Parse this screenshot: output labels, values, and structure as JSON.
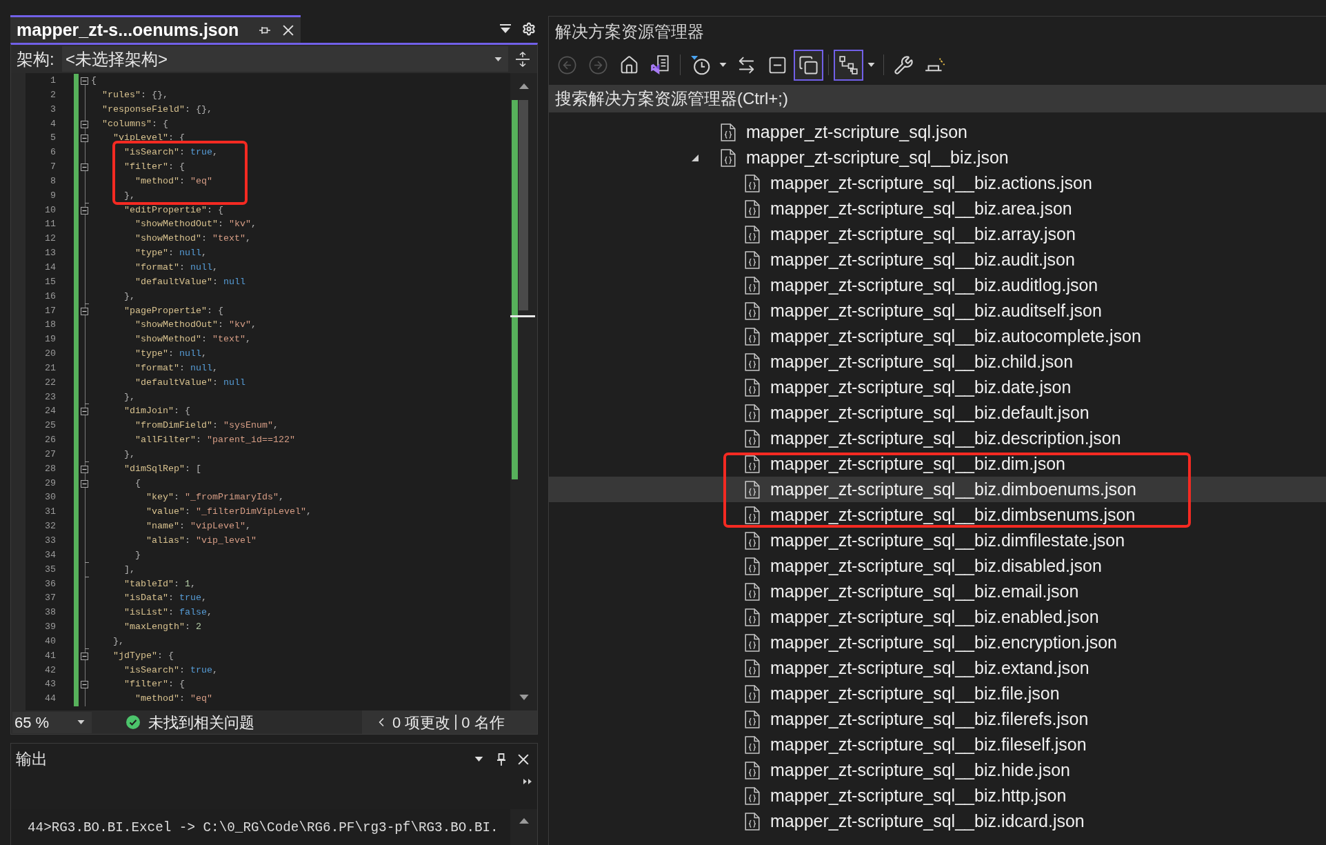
{
  "editor": {
    "tabs": [
      {
        "title": "mapper_zt-s...oenums.json",
        "selected": true
      }
    ],
    "navigation": {
      "label": "架构:",
      "value": "<未选择架构>"
    },
    "lines": [
      {
        "number": "1",
        "changed": true,
        "expanded": true,
        "tokens": [
          {
            "kind": "punct",
            "text": "{"
          }
        ]
      },
      {
        "number": "2",
        "changed": true,
        "tokens": [
          {
            "kind": "key",
            "text": "  \"rules\""
          },
          {
            "kind": "punct",
            "text": ": {},"
          }
        ]
      },
      {
        "number": "3",
        "changed": true,
        "tokens": [
          {
            "kind": "key",
            "text": "  \"responseField\""
          },
          {
            "kind": "punct",
            "text": ": {},"
          }
        ]
      },
      {
        "number": "4",
        "changed": true,
        "expanded": true,
        "tokens": [
          {
            "kind": "key",
            "text": "  \"columns\""
          },
          {
            "kind": "punct",
            "text": ": {"
          }
        ]
      },
      {
        "number": "5",
        "changed": true,
        "expanded": true,
        "tokens": [
          {
            "kind": "key",
            "text": "    \"vipLevel\""
          },
          {
            "kind": "punct",
            "text": ": {"
          }
        ]
      },
      {
        "number": "6",
        "changed": true,
        "tokens": [
          {
            "kind": "key",
            "text": "      \"isSearch\""
          },
          {
            "kind": "punct",
            "text": ": "
          },
          {
            "kind": "keyword",
            "text": "true"
          },
          {
            "kind": "punct",
            "text": ","
          }
        ]
      },
      {
        "number": "7",
        "changed": true,
        "expanded": true,
        "tokens": [
          {
            "kind": "key",
            "text": "      \"filter\""
          },
          {
            "kind": "punct",
            "text": ": {"
          }
        ]
      },
      {
        "number": "8",
        "changed": true,
        "tokens": [
          {
            "kind": "key",
            "text": "        \"method\""
          },
          {
            "kind": "punct",
            "text": ": "
          },
          {
            "kind": "string",
            "text": "\"eq\""
          }
        ]
      },
      {
        "number": "9",
        "changed": true,
        "fold_end": true,
        "tokens": [
          {
            "kind": "punct",
            "text": "      },"
          }
        ]
      },
      {
        "number": "10",
        "changed": true,
        "expanded": true,
        "tokens": [
          {
            "kind": "key",
            "text": "      \"editPropertie\""
          },
          {
            "kind": "punct",
            "text": ": {"
          }
        ]
      },
      {
        "number": "11",
        "changed": true,
        "tokens": [
          {
            "kind": "key",
            "text": "        \"showMethodOut\""
          },
          {
            "kind": "punct",
            "text": ": "
          },
          {
            "kind": "string",
            "text": "\"kv\""
          },
          {
            "kind": "punct",
            "text": ","
          }
        ]
      },
      {
        "number": "12",
        "changed": true,
        "tokens": [
          {
            "kind": "key",
            "text": "        \"showMethod\""
          },
          {
            "kind": "punct",
            "text": ": "
          },
          {
            "kind": "string",
            "text": "\"text\""
          },
          {
            "kind": "punct",
            "text": ","
          }
        ]
      },
      {
        "number": "13",
        "changed": true,
        "tokens": [
          {
            "kind": "key",
            "text": "        \"type\""
          },
          {
            "kind": "punct",
            "text": ": "
          },
          {
            "kind": "keyword",
            "text": "null"
          },
          {
            "kind": "punct",
            "text": ","
          }
        ]
      },
      {
        "number": "14",
        "changed": true,
        "tokens": [
          {
            "kind": "key",
            "text": "        \"format\""
          },
          {
            "kind": "punct",
            "text": ": "
          },
          {
            "kind": "keyword",
            "text": "null"
          },
          {
            "kind": "punct",
            "text": ","
          }
        ]
      },
      {
        "number": "15",
        "changed": true,
        "tokens": [
          {
            "kind": "key",
            "text": "        \"defaultValue\""
          },
          {
            "kind": "punct",
            "text": ": "
          },
          {
            "kind": "keyword",
            "text": "null"
          }
        ]
      },
      {
        "number": "16",
        "changed": true,
        "fold_end": true,
        "tokens": [
          {
            "kind": "punct",
            "text": "      },"
          }
        ]
      },
      {
        "number": "17",
        "changed": true,
        "expanded": true,
        "tokens": [
          {
            "kind": "key",
            "text": "      \"pagePropertie\""
          },
          {
            "kind": "punct",
            "text": ": {"
          }
        ]
      },
      {
        "number": "18",
        "changed": true,
        "tokens": [
          {
            "kind": "key",
            "text": "        \"showMethodOut\""
          },
          {
            "kind": "punct",
            "text": ": "
          },
          {
            "kind": "string",
            "text": "\"kv\""
          },
          {
            "kind": "punct",
            "text": ","
          }
        ]
      },
      {
        "number": "19",
        "changed": true,
        "tokens": [
          {
            "kind": "key",
            "text": "        \"showMethod\""
          },
          {
            "kind": "punct",
            "text": ": "
          },
          {
            "kind": "string",
            "text": "\"text\""
          },
          {
            "kind": "punct",
            "text": ","
          }
        ]
      },
      {
        "number": "20",
        "changed": true,
        "tokens": [
          {
            "kind": "key",
            "text": "        \"type\""
          },
          {
            "kind": "punct",
            "text": ": "
          },
          {
            "kind": "keyword",
            "text": "null"
          },
          {
            "kind": "punct",
            "text": ","
          }
        ]
      },
      {
        "number": "21",
        "changed": true,
        "tokens": [
          {
            "kind": "key",
            "text": "        \"format\""
          },
          {
            "kind": "punct",
            "text": ": "
          },
          {
            "kind": "keyword",
            "text": "null"
          },
          {
            "kind": "punct",
            "text": ","
          }
        ]
      },
      {
        "number": "22",
        "changed": true,
        "tokens": [
          {
            "kind": "key",
            "text": "        \"defaultValue\""
          },
          {
            "kind": "punct",
            "text": ": "
          },
          {
            "kind": "keyword",
            "text": "null"
          }
        ]
      },
      {
        "number": "23",
        "changed": true,
        "fold_end": true,
        "tokens": [
          {
            "kind": "punct",
            "text": "      },"
          }
        ]
      },
      {
        "number": "24",
        "changed": true,
        "expanded": true,
        "tokens": [
          {
            "kind": "key",
            "text": "      \"dimJoin\""
          },
          {
            "kind": "punct",
            "text": ": {"
          }
        ]
      },
      {
        "number": "25",
        "changed": true,
        "tokens": [
          {
            "kind": "key",
            "text": "        \"fromDimField\""
          },
          {
            "kind": "punct",
            "text": ": "
          },
          {
            "kind": "string",
            "text": "\"sysEnum\""
          },
          {
            "kind": "punct",
            "text": ","
          }
        ]
      },
      {
        "number": "26",
        "changed": true,
        "tokens": [
          {
            "kind": "key",
            "text": "        \"allFilter\""
          },
          {
            "kind": "punct",
            "text": ": "
          },
          {
            "kind": "string",
            "text": "\"parent_id==122\""
          }
        ]
      },
      {
        "number": "27",
        "changed": true,
        "fold_end": true,
        "tokens": [
          {
            "kind": "punct",
            "text": "      },"
          }
        ]
      },
      {
        "number": "28",
        "changed": true,
        "expanded": true,
        "tokens": [
          {
            "kind": "key",
            "text": "      \"dimSqlRep\""
          },
          {
            "kind": "punct",
            "text": ": ["
          }
        ]
      },
      {
        "number": "29",
        "changed": true,
        "expanded": true,
        "tokens": [
          {
            "kind": "punct",
            "text": "        {"
          }
        ]
      },
      {
        "number": "30",
        "changed": true,
        "tokens": [
          {
            "kind": "key",
            "text": "          \"key\""
          },
          {
            "kind": "punct",
            "text": ": "
          },
          {
            "kind": "string",
            "text": "\"_fromPrimaryIds\""
          },
          {
            "kind": "punct",
            "text": ","
          }
        ]
      },
      {
        "number": "31",
        "changed": true,
        "tokens": [
          {
            "kind": "key",
            "text": "          \"value\""
          },
          {
            "kind": "punct",
            "text": ": "
          },
          {
            "kind": "string",
            "text": "\"_filterDimVipLevel\""
          },
          {
            "kind": "punct",
            "text": ","
          }
        ]
      },
      {
        "number": "32",
        "changed": true,
        "tokens": [
          {
            "kind": "key",
            "text": "          \"name\""
          },
          {
            "kind": "punct",
            "text": ": "
          },
          {
            "kind": "string",
            "text": "\"vipLevel\""
          },
          {
            "kind": "punct",
            "text": ","
          }
        ]
      },
      {
        "number": "33",
        "changed": true,
        "tokens": [
          {
            "kind": "key",
            "text": "          \"alias\""
          },
          {
            "kind": "punct",
            "text": ": "
          },
          {
            "kind": "string",
            "text": "\"vip_level\""
          }
        ]
      },
      {
        "number": "34",
        "changed": true,
        "fold_end": true,
        "tokens": [
          {
            "kind": "punct",
            "text": "        }"
          }
        ]
      },
      {
        "number": "35",
        "changed": true,
        "fold_end": true,
        "tokens": [
          {
            "kind": "punct",
            "text": "      ],"
          }
        ]
      },
      {
        "number": "36",
        "changed": true,
        "tokens": [
          {
            "kind": "key",
            "text": "      \"tableId\""
          },
          {
            "kind": "punct",
            "text": ": "
          },
          {
            "kind": "number",
            "text": "1"
          },
          {
            "kind": "punct",
            "text": ","
          }
        ]
      },
      {
        "number": "37",
        "changed": true,
        "tokens": [
          {
            "kind": "key",
            "text": "      \"isData\""
          },
          {
            "kind": "punct",
            "text": ": "
          },
          {
            "kind": "keyword",
            "text": "true"
          },
          {
            "kind": "punct",
            "text": ","
          }
        ]
      },
      {
        "number": "38",
        "changed": true,
        "tokens": [
          {
            "kind": "key",
            "text": "      \"isList\""
          },
          {
            "kind": "punct",
            "text": ": "
          },
          {
            "kind": "keyword",
            "text": "false"
          },
          {
            "kind": "punct",
            "text": ","
          }
        ]
      },
      {
        "number": "39",
        "changed": true,
        "tokens": [
          {
            "kind": "key",
            "text": "      \"maxLength\""
          },
          {
            "kind": "punct",
            "text": ": "
          },
          {
            "kind": "number",
            "text": "2"
          }
        ]
      },
      {
        "number": "40",
        "changed": true,
        "fold_end": true,
        "tokens": [
          {
            "kind": "punct",
            "text": "    },"
          }
        ]
      },
      {
        "number": "41",
        "changed": true,
        "expanded": true,
        "tokens": [
          {
            "kind": "key",
            "text": "    \"jdType\""
          },
          {
            "kind": "punct",
            "text": ": {"
          }
        ]
      },
      {
        "number": "42",
        "changed": true,
        "tokens": [
          {
            "kind": "key",
            "text": "      \"isSearch\""
          },
          {
            "kind": "punct",
            "text": ": "
          },
          {
            "kind": "keyword",
            "text": "true"
          },
          {
            "kind": "punct",
            "text": ","
          }
        ]
      },
      {
        "number": "43",
        "changed": true,
        "expanded": true,
        "tokens": [
          {
            "kind": "key",
            "text": "      \"filter\""
          },
          {
            "kind": "punct",
            "text": ": {"
          }
        ]
      },
      {
        "number": "44",
        "changed": true,
        "tokens": [
          {
            "kind": "key",
            "text": "        \"method\""
          },
          {
            "kind": "punct",
            "text": ": "
          },
          {
            "kind": "string",
            "text": "\"eq\""
          }
        ]
      }
    ],
    "status": {
      "zoom": "65 %",
      "issues": "未找到相关问题",
      "changes": "0 项更改",
      "authors": "0 名作"
    }
  },
  "output": {
    "title": "输出",
    "lines": [
      "44>RG3.BO.BI.Excel -> C:\\0_RG\\Code\\RG6.PF\\rg3-pf\\RG3.BO.BI."
    ]
  },
  "solution_explorer": {
    "title": "解决方案资源管理器",
    "toolbar": {
      "groups": [
        [
          {
            "kind": "button",
            "disabled": true,
            "on": false
          },
          {
            "kind": "button",
            "disabled": true,
            "on": false
          },
          {
            "kind": "button",
            "disabled": false,
            "on": false
          },
          {
            "kind": "button",
            "disabled": false,
            "on": false
          }
        ],
        [
          {
            "kind": "split",
            "disabled": false,
            "on": false
          },
          {
            "kind": "button",
            "disabled": false,
            "on": false
          },
          {
            "kind": "button",
            "disabled": false,
            "on": false
          },
          {
            "kind": "button",
            "disabled": false,
            "on": true
          }
        ],
        [
          {
            "kind": "split",
            "disabled": false,
            "on": true
          }
        ],
        [
          {
            "kind": "button",
            "disabled": false,
            "on": false
          },
          {
            "kind": "button",
            "disabled": false,
            "on": false
          }
        ]
      ]
    },
    "search": {
      "placeholder": "搜索解决方案资源管理器(Ctrl+;)"
    },
    "items": [
      {
        "label": "mapper_zt-scripture_sql.json",
        "selected": false
      },
      {
        "label": "mapper_zt-scripture_sql__biz.json",
        "selected": false,
        "expanded": true,
        "children": [
          {
            "label": "mapper_zt-scripture_sql__biz.actions.json",
            "selected": false
          },
          {
            "label": "mapper_zt-scripture_sql__biz.area.json",
            "selected": false
          },
          {
            "label": "mapper_zt-scripture_sql__biz.array.json",
            "selected": false
          },
          {
            "label": "mapper_zt-scripture_sql__biz.audit.json",
            "selected": false
          },
          {
            "label": "mapper_zt-scripture_sql__biz.auditlog.json",
            "selected": false
          },
          {
            "label": "mapper_zt-scripture_sql__biz.auditself.json",
            "selected": false
          },
          {
            "label": "mapper_zt-scripture_sql__biz.autocomplete.json",
            "selected": false
          },
          {
            "label": "mapper_zt-scripture_sql__biz.child.json",
            "selected": false
          },
          {
            "label": "mapper_zt-scripture_sql__biz.date.json",
            "selected": false
          },
          {
            "label": "mapper_zt-scripture_sql__biz.default.json",
            "selected": false
          },
          {
            "label": "mapper_zt-scripture_sql__biz.description.json",
            "selected": false
          },
          {
            "label": "mapper_zt-scripture_sql__biz.dim.json",
            "selected": false
          },
          {
            "label": "mapper_zt-scripture_sql__biz.dimboenums.json",
            "selected": true
          },
          {
            "label": "mapper_zt-scripture_sql__biz.dimbsenums.json",
            "selected": false
          },
          {
            "label": "mapper_zt-scripture_sql__biz.dimfilestate.json",
            "selected": false
          },
          {
            "label": "mapper_zt-scripture_sql__biz.disabled.json",
            "selected": false
          },
          {
            "label": "mapper_zt-scripture_sql__biz.email.json",
            "selected": false
          },
          {
            "label": "mapper_zt-scripture_sql__biz.enabled.json",
            "selected": false
          },
          {
            "label": "mapper_zt-scripture_sql__biz.encryption.json",
            "selected": false
          },
          {
            "label": "mapper_zt-scripture_sql__biz.extand.json",
            "selected": false
          },
          {
            "label": "mapper_zt-scripture_sql__biz.file.json",
            "selected": false
          },
          {
            "label": "mapper_zt-scripture_sql__biz.filerefs.json",
            "selected": false
          },
          {
            "label": "mapper_zt-scripture_sql__biz.fileself.json",
            "selected": false
          },
          {
            "label": "mapper_zt-scripture_sql__biz.hide.json",
            "selected": false
          },
          {
            "label": "mapper_zt-scripture_sql__biz.http.json",
            "selected": false
          },
          {
            "label": "mapper_zt-scripture_sql__biz.idcard.json",
            "selected": false
          }
        ]
      }
    ]
  }
}
